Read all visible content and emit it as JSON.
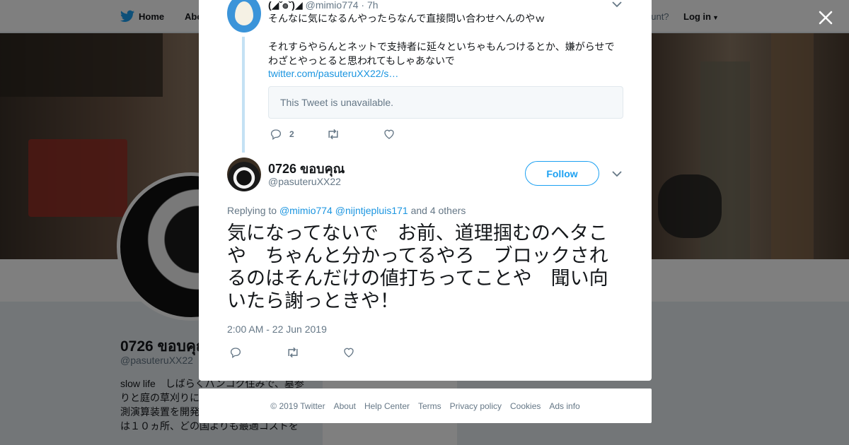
{
  "topbar": {
    "home_label": "Home",
    "about_label": "Abo",
    "have_account": "ccount?",
    "login_label": "Log in"
  },
  "profile": {
    "name": "0726 ขอบคุณ",
    "handle": "@pasuteruXX22",
    "bio": "slow life　しばらくバンコク住みで、墓参りと庭の草刈りに…出さず税は納めて… 測演算装置を開発(世界中で使われ日本では１０ヵ所、どの国よりも最適コストを"
  },
  "parent_tweet": {
    "name": "(◢ˇ๏ˇ)◢",
    "handle": "@mimio774",
    "time": "· 7h",
    "paragraphs": [
      "そんなに気になるんやったらなんで直接問い合わせへんのやｗ",
      "それすらやらんとネットで支持者に延々といちゃもんつけるとか、嫌がらせでわざとやっとると思われてもしゃあないで"
    ],
    "link": "twitter.com/pasuteruXX22/s…",
    "quoted_unavailable": "This Tweet is unavailable.",
    "reply_count": "2"
  },
  "main_tweet": {
    "name": "0726 ขอบคุณ",
    "handle": "@pasuteruXX22",
    "follow_label": "Follow",
    "replying_prefix": "Replying to",
    "mention_1": "@mimio774",
    "mention_2": "@nijntjepluis171",
    "replying_suffix": "and 4 others",
    "text": "気になってないで　お前、道理掴むのヘタこや　ちゃんと分かってるやろ　ブロックされるのはそんだけの値打ちってことや　聞い向いたら謝っときや！",
    "timestamp": "2:00 AM - 22 Jun 2019"
  },
  "footer": {
    "copyright": "© 2019 Twitter",
    "links": [
      "About",
      "Help Center",
      "Terms",
      "Privacy policy",
      "Cookies",
      "Ads info"
    ]
  },
  "colors": {
    "accent": "#1da1f2",
    "link": "#1b95e0",
    "muted": "#657786",
    "text": "#14171a",
    "thread_line": "#c4e1f4"
  }
}
